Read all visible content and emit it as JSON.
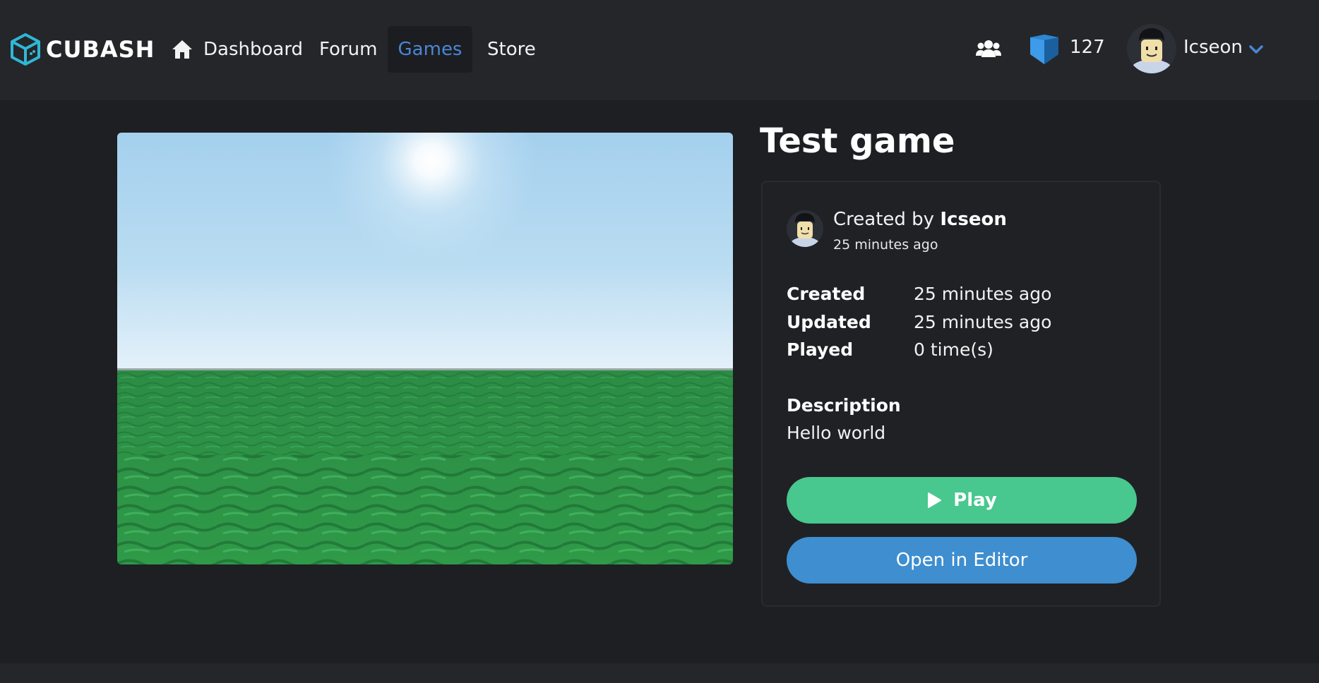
{
  "header": {
    "brand": "CUBASH",
    "nav": [
      {
        "label": "Dashboard",
        "icon": "home-icon"
      },
      {
        "label": "Forum"
      },
      {
        "label": "Games",
        "active": true
      },
      {
        "label": "Store"
      }
    ],
    "friends_icon": "friends-icon",
    "currency": {
      "icon": "cube-currency-icon",
      "amount": "127"
    },
    "user": {
      "name": "Icseon",
      "menu_icon": "chevron-down-icon"
    }
  },
  "game": {
    "title": "Test game",
    "creator_prefix": "Created by",
    "creator_name": "Icseon",
    "creator_time": "25 minutes ago",
    "stats": [
      {
        "label": "Created",
        "value": "25 minutes ago"
      },
      {
        "label": "Updated",
        "value": "25 minutes ago"
      },
      {
        "label": "Played",
        "value": "0 time(s)"
      }
    ],
    "description_label": "Description",
    "description": "Hello world",
    "play_label": "Play",
    "editor_label": "Open in Editor"
  },
  "colors": {
    "background": "#1e1f23",
    "header": "#25262a",
    "accent_link": "#4a86d6",
    "play_green": "#48c78e",
    "editor_blue": "#3e8ed0"
  }
}
